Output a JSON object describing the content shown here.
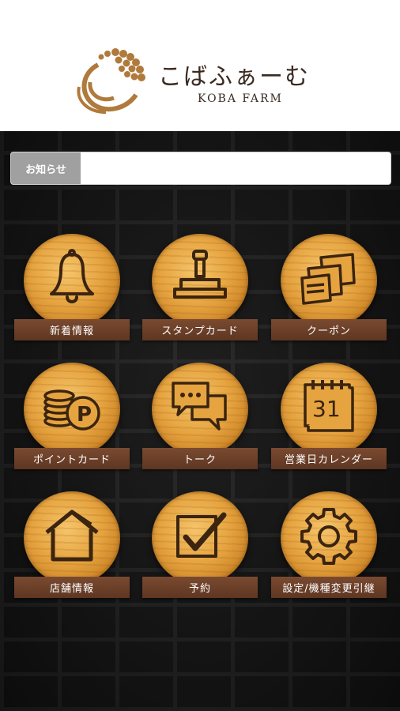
{
  "brand": {
    "name_jp": "こばふぁーむ",
    "name_en": "KOBA FARM",
    "accent": "#b07a3c"
  },
  "notice": {
    "label": "お知らせ",
    "text": ""
  },
  "menu": [
    {
      "label": "新着情報",
      "icon": "bell-icon"
    },
    {
      "label": "スタンプカード",
      "icon": "stamp-icon"
    },
    {
      "label": "クーポン",
      "icon": "coupon-icon"
    },
    {
      "label": "ポイントカード",
      "icon": "point-coins-icon"
    },
    {
      "label": "トーク",
      "icon": "chat-bubbles-icon"
    },
    {
      "label": "営業日カレンダー",
      "icon": "calendar-icon",
      "calendar_day": "31"
    },
    {
      "label": "店舗情報",
      "icon": "house-icon"
    },
    {
      "label": "予約",
      "icon": "checkbox-icon"
    },
    {
      "label": "設定/機種変更引継",
      "icon": "gear-icon"
    }
  ]
}
